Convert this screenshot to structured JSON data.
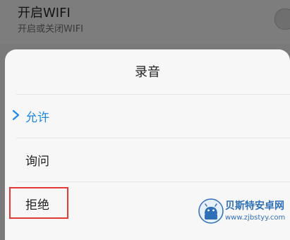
{
  "background_setting": {
    "title": "开启WIFI",
    "subtitle": "开启或关闭WIFI"
  },
  "dialog": {
    "title": "录音",
    "options": [
      {
        "label": "允许",
        "selected": true
      },
      {
        "label": "询问",
        "selected": false
      },
      {
        "label": "拒绝",
        "selected": false,
        "highlighted": true
      }
    ]
  },
  "watermark": {
    "name": "贝斯特安卓网",
    "url": "www.zjbstyy.com"
  },
  "colors": {
    "selected_accent": "#1e88e5",
    "highlight_box": "#e53935"
  }
}
